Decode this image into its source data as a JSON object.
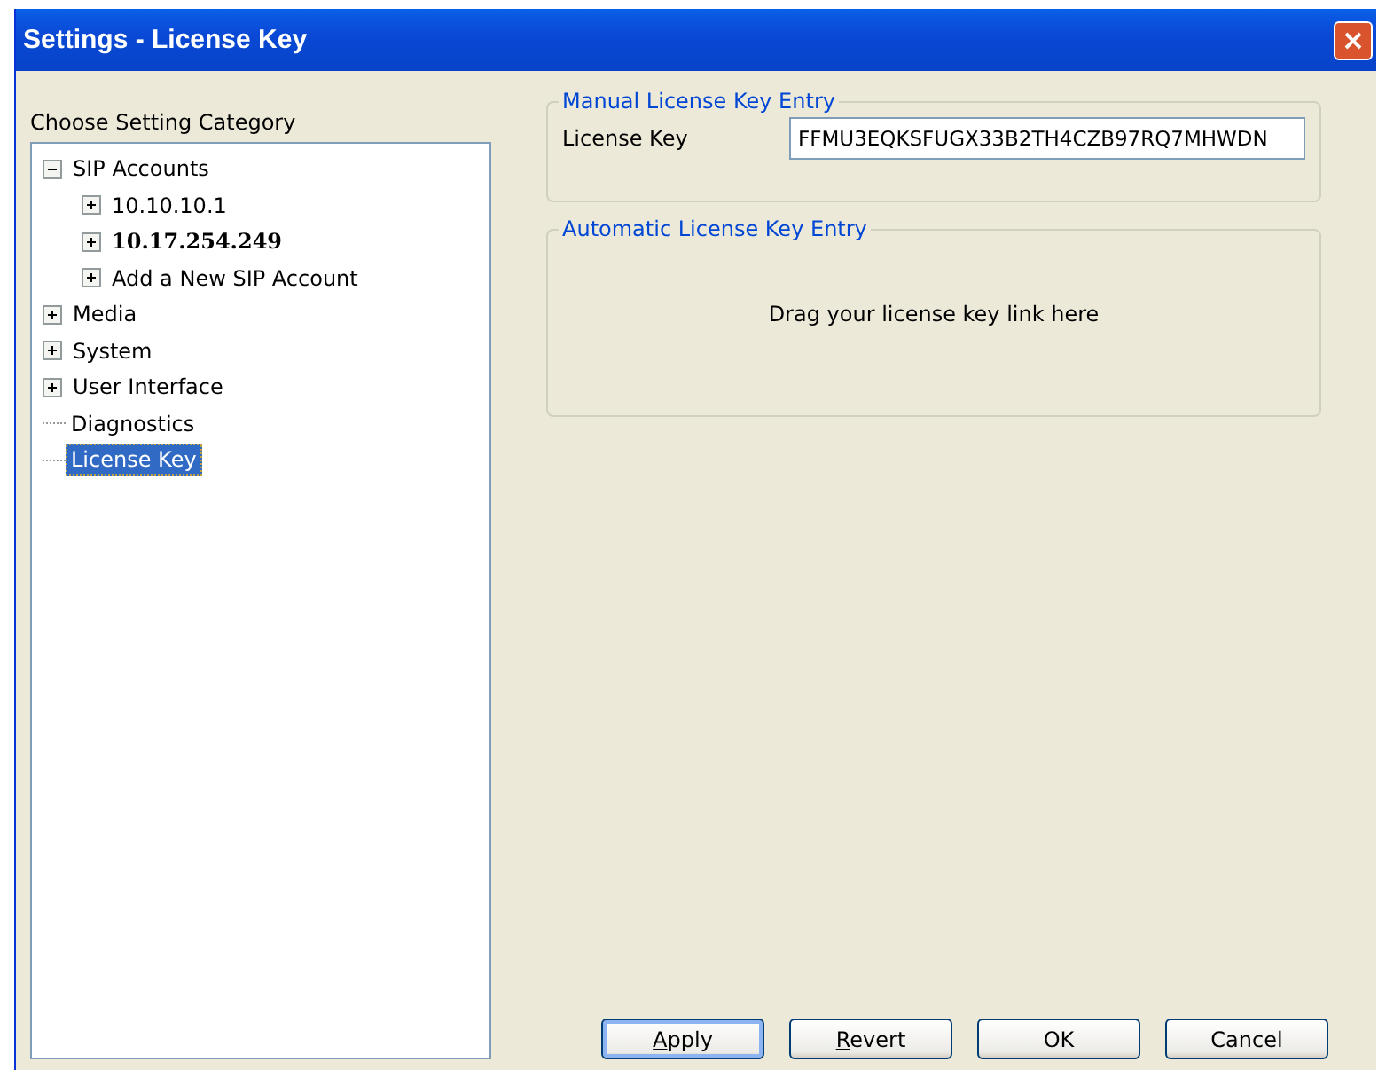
{
  "window": {
    "title": "Settings - License Key"
  },
  "category_label": "Choose Setting Category",
  "tree": [
    {
      "kind": "folder",
      "label": "SIP Accounts",
      "expanded": true,
      "selected": false,
      "bold": false,
      "children": [
        {
          "kind": "folder",
          "label": "10.10.10.1",
          "expanded": false,
          "selected": false,
          "bold": false
        },
        {
          "kind": "folder",
          "label": "10.17.254.249",
          "expanded": false,
          "selected": false,
          "bold": true
        },
        {
          "kind": "folder",
          "label": "Add a New SIP Account",
          "expanded": false,
          "selected": false,
          "bold": false
        }
      ]
    },
    {
      "kind": "folder",
      "label": "Media",
      "expanded": false,
      "selected": false,
      "bold": false
    },
    {
      "kind": "folder",
      "label": "System",
      "expanded": false,
      "selected": false,
      "bold": false
    },
    {
      "kind": "folder",
      "label": "User Interface",
      "expanded": false,
      "selected": false,
      "bold": false
    },
    {
      "kind": "leaf",
      "label": "Diagnostics",
      "selected": false,
      "bold": false
    },
    {
      "kind": "leaf",
      "label": "License Key",
      "selected": true,
      "bold": false
    }
  ],
  "manual_group": {
    "title": "Manual License Key Entry",
    "field_label": "License Key",
    "value": "FFMU3EQKSFUGX33B2TH4CZB97RQ7MHWDN"
  },
  "automatic_group": {
    "title": "Automatic License Key Entry",
    "hint": "Drag your license key link here"
  },
  "buttons": [
    {
      "label": "Apply",
      "underline_first": true,
      "default": true
    },
    {
      "label": "Revert",
      "underline_first": true,
      "default": false
    },
    {
      "label": "OK",
      "underline_first": false,
      "default": false
    },
    {
      "label": "Cancel",
      "underline_first": false,
      "default": false
    }
  ]
}
